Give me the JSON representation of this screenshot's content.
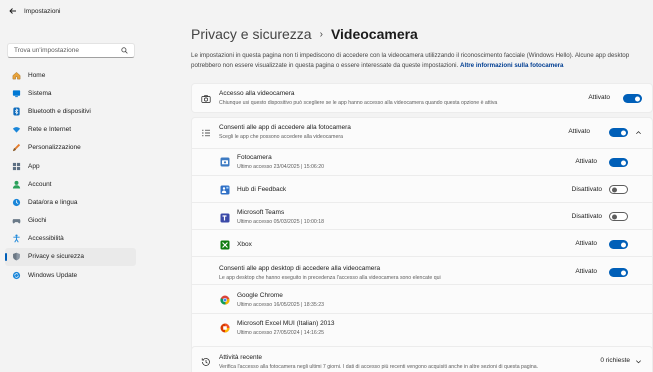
{
  "window": {
    "title": "Impostazioni"
  },
  "search": {
    "placeholder": "Trova un'impostazione"
  },
  "nav": [
    {
      "label": "Home",
      "icon": "home-icon",
      "active": false
    },
    {
      "label": "Sistema",
      "icon": "system-icon",
      "active": false
    },
    {
      "label": "Bluetooth e dispositivi",
      "icon": "bluetooth-icon",
      "active": false
    },
    {
      "label": "Rete e Internet",
      "icon": "wifi-icon",
      "active": false
    },
    {
      "label": "Personalizzazione",
      "icon": "brush-icon",
      "active": false
    },
    {
      "label": "App",
      "icon": "apps-icon",
      "active": false
    },
    {
      "label": "Account",
      "icon": "account-icon",
      "active": false
    },
    {
      "label": "Data/ora e lingua",
      "icon": "globe-clock-icon",
      "active": false
    },
    {
      "label": "Giochi",
      "icon": "gamepad-icon",
      "active": false
    },
    {
      "label": "Accessibilità",
      "icon": "accessibility-icon",
      "active": false
    },
    {
      "label": "Privacy e sicurezza",
      "icon": "shield-icon",
      "active": true
    },
    {
      "label": "Windows Update",
      "icon": "update-icon",
      "active": false
    }
  ],
  "header": {
    "parent": "Privacy e sicurezza",
    "separator": "›",
    "current": "Videocamera"
  },
  "description": {
    "text": "Le impostazioni in questa pagina non ti impediscono di accedere con la videocamera utilizzando il riconoscimento facciale (Windows Hello). Alcune app desktop potrebbero non essere visualizzate in questa pagina o essere interessate da queste impostazioni.",
    "link": "Altre informazioni sulla fotocamera"
  },
  "camera_access": {
    "title": "Accesso alla videocamera",
    "subtitle": "Chiunque usi questo dispositivo può scegliere se le app hanno accesso alla videocamera quando questa opzione è attiva",
    "state": "Attivato",
    "on": true
  },
  "app_access": {
    "title": "Consenti alle app di accedere alla fotocamera",
    "subtitle": "Scegli le app che possono accedere alla videocamera",
    "state": "Attivato",
    "on": true,
    "apps": [
      {
        "name": "Fotocamera",
        "last": "Ultimo accesso 23/04/2025 | 15:06:20",
        "state": "Attivato",
        "on": true,
        "icon": "camera-app-icon"
      },
      {
        "name": "Hub di Feedback",
        "last": "",
        "state": "Disattivato",
        "on": false,
        "icon": "feedback-hub-icon"
      },
      {
        "name": "Microsoft Teams",
        "last": "Ultimo accesso 05/03/2025 | 10:00:18",
        "state": "Disattivato",
        "on": false,
        "icon": "teams-icon"
      },
      {
        "name": "Xbox",
        "last": "",
        "state": "Attivato",
        "on": true,
        "icon": "xbox-icon"
      }
    ]
  },
  "desktop_access": {
    "title": "Consenti alle app desktop di accedere alla videocamera",
    "subtitle": "Le app desktop che hanno eseguito in precedenza l'accesso alla videocamera sono elencate qui",
    "state": "Attivato",
    "on": true,
    "apps": [
      {
        "name": "Google Chrome",
        "last": "Ultimo accesso 16/05/2025 | 18:35:23",
        "icon": "chrome-icon"
      },
      {
        "name": "Microsoft Excel MUI (Italian) 2013",
        "last": "Ultimo accesso 27/05/2024 | 14:16:25",
        "icon": "office-icon"
      }
    ]
  },
  "recent": {
    "title": "Attività recente",
    "subtitle": "Verifica l'accesso alla fotocamera negli ultimi 7 giorni. I dati di accesso più recenti vengono acquisiti anche in altre sezioni di questa pagina.",
    "count": "0 richieste"
  },
  "colors": {
    "accent": "#005fb8",
    "background": "#f3f3f3",
    "card": "#fbfbfb"
  }
}
